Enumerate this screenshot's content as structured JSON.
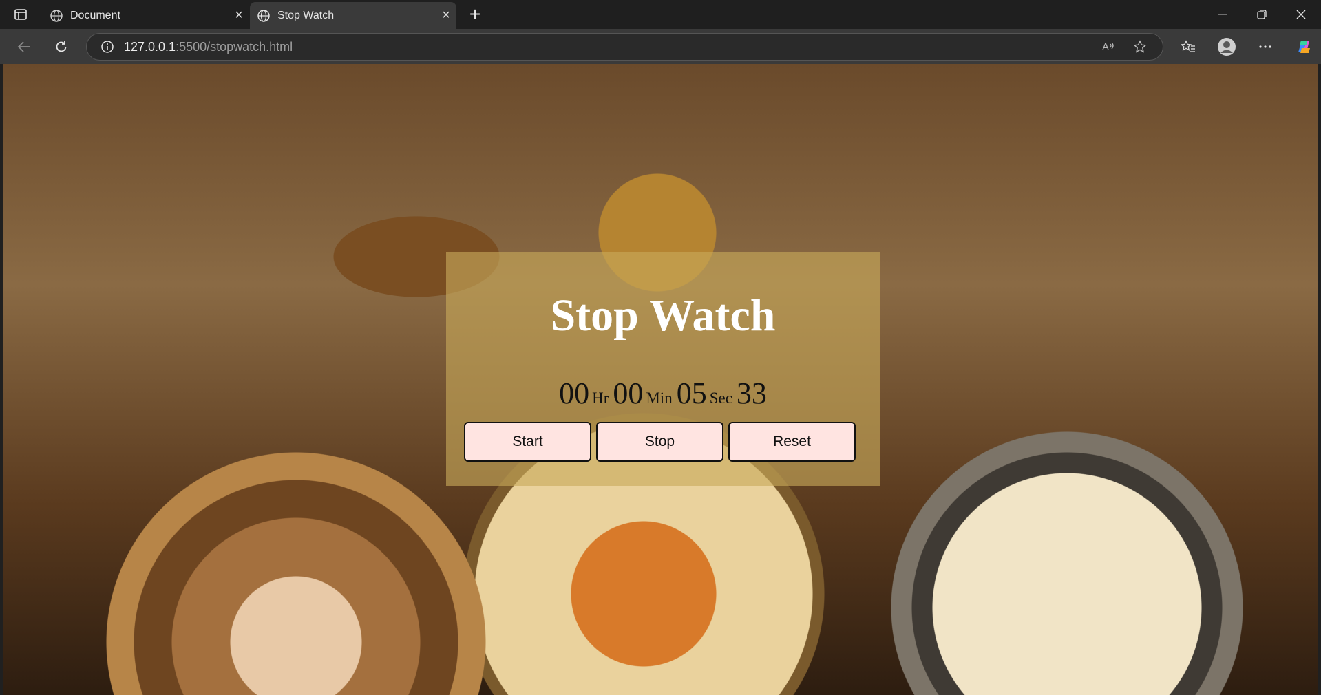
{
  "browser": {
    "tabs": [
      {
        "title": "Document",
        "icon": "globe-icon",
        "active": false
      },
      {
        "title": "Stop Watch",
        "icon": "globe-icon",
        "active": true
      }
    ],
    "address": {
      "host": "127.0.0.1",
      "path": ":5500/stopwatch.html"
    }
  },
  "page": {
    "title": "Stop Watch",
    "time": {
      "hours": "00",
      "hours_unit": "Hr",
      "minutes": "00",
      "minutes_unit": "Min",
      "seconds": "05",
      "seconds_unit": "Sec",
      "centiseconds": "33"
    },
    "buttons": {
      "start": "Start",
      "stop": "Stop",
      "reset": "Reset"
    },
    "background": "vintage pocket watches",
    "colors": {
      "panel": "#c8aa5a",
      "button_bg": "#ffe4e1",
      "title": "#ffffff"
    }
  }
}
